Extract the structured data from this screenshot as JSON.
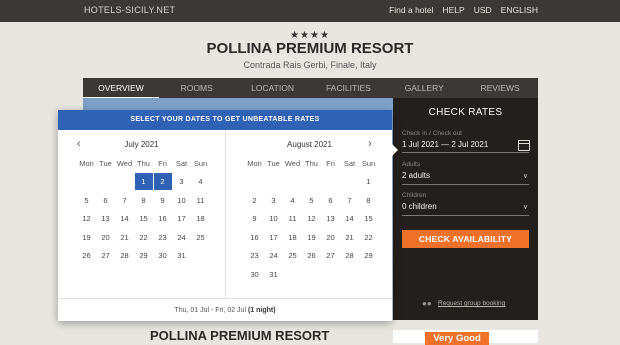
{
  "site": {
    "brand": "HOTELS-SICILY.NET",
    "nav": [
      "Find a hotel",
      "HELP",
      "USD",
      "ENGLISH"
    ]
  },
  "hotel": {
    "stars": "★★★★",
    "name": "POLLINA PREMIUM RESORT",
    "address": "Contrada Rais Gerbi, Finale, Italy"
  },
  "tabs": [
    "OVERVIEW",
    "ROOMS",
    "LOCATION",
    "FACILITIES",
    "GALLERY",
    "REVIEWS"
  ],
  "rates": {
    "title": "CHECK RATES",
    "dates_label": "Check in / Check out",
    "dates_value": "1 Jul 2021 — 2 Jul 2021",
    "adults_label": "Adults",
    "adults_value": "2 adults",
    "children_label": "Children",
    "children_value": "0 children",
    "button": "CHECK AVAILABILITY",
    "group_link": "Request group booking"
  },
  "datepicker": {
    "header": "SELECT YOUR DATES TO GET UNBEATABLE RATES",
    "dow": [
      "Mon",
      "Tue",
      "Wed",
      "Thu",
      "Fri",
      "Sat",
      "Sun"
    ],
    "months": [
      {
        "title": "July 2021",
        "weeks": [
          [
            "",
            "",
            "",
            "1",
            "2",
            "3",
            "4"
          ],
          [
            "5",
            "6",
            "7",
            "8",
            "9",
            "10",
            "11"
          ],
          [
            "12",
            "13",
            "14",
            "15",
            "16",
            "17",
            "18"
          ],
          [
            "19",
            "20",
            "21",
            "22",
            "23",
            "24",
            "25"
          ],
          [
            "26",
            "27",
            "28",
            "29",
            "30",
            "31",
            ""
          ]
        ]
      },
      {
        "title": "August 2021",
        "weeks": [
          [
            "",
            "",
            "",
            "",
            "",
            "",
            "1"
          ],
          [
            "2",
            "3",
            "4",
            "5",
            "6",
            "7",
            "8"
          ],
          [
            "9",
            "10",
            "11",
            "12",
            "13",
            "14",
            "15"
          ],
          [
            "16",
            "17",
            "18",
            "19",
            "20",
            "21",
            "22"
          ],
          [
            "23",
            "24",
            "25",
            "26",
            "27",
            "28",
            "29"
          ],
          [
            "30",
            "31",
            "",
            "",
            "",
            "",
            ""
          ]
        ]
      }
    ],
    "selected": [
      "1",
      "2"
    ],
    "footer_range": "Thu, 01 Jul - Fri, 02 Jul",
    "footer_nights": "(1 night)"
  },
  "bottom": {
    "name": "POLLINA PREMIUM RESORT",
    "rating": "Very Good"
  },
  "colors": {
    "accent": "#f0712a",
    "picker_blue": "#2f62b5",
    "dark": "#3c3835"
  }
}
